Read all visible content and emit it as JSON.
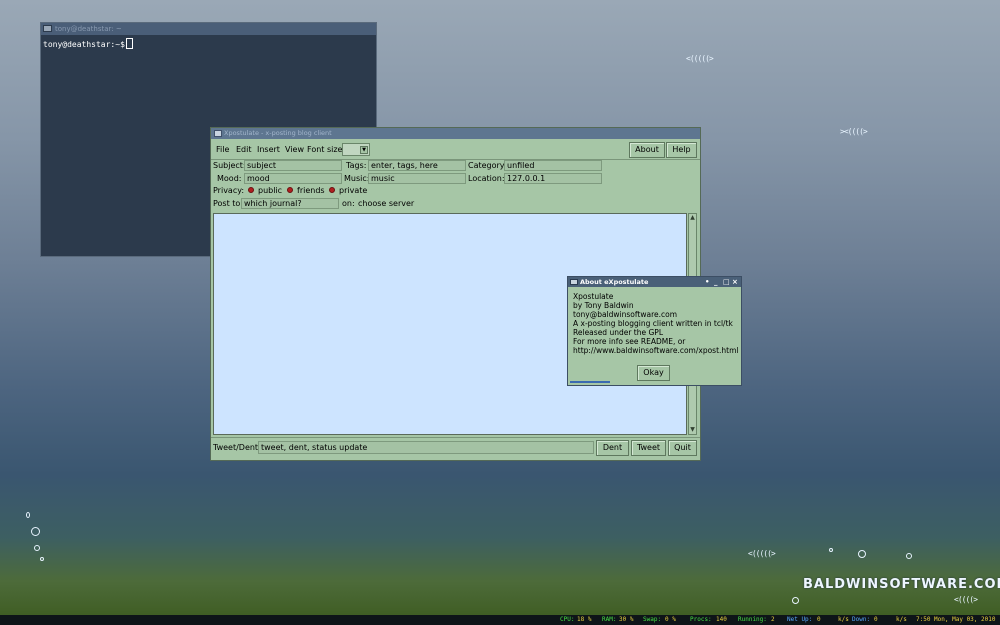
{
  "terminal": {
    "title": "tony@deathstar: ~",
    "prompt": "tony@deathstar:~$"
  },
  "xpostulate": {
    "title": "Xpostulate - x-posting blog client",
    "menu": {
      "file": "File",
      "edit": "Edit",
      "insert": "Insert",
      "view": "View",
      "font_size": "Font size:"
    },
    "buttons": {
      "about": "About",
      "help": "Help",
      "dent": "Dent",
      "tweet": "Tweet",
      "quit": "Quit"
    },
    "subject": {
      "label": "Subject:",
      "value": "subject"
    },
    "tags": {
      "label": "Tags:",
      "value": "enter, tags, here"
    },
    "category": {
      "label": "Category:",
      "value": "unfiled"
    },
    "mood": {
      "label": "Mood:",
      "value": "mood"
    },
    "music": {
      "label": "Music:",
      "value": "music"
    },
    "location": {
      "label": "Location:",
      "value": "127.0.0.1"
    },
    "privacy": {
      "label": "Privacy:",
      "public": "public",
      "friends": "friends",
      "private": "private"
    },
    "post_to": {
      "label": "Post to:",
      "value": "which journal?",
      "on_label": "on:",
      "server": "choose server"
    },
    "tweet_dent": {
      "label": "Tweet/Dent:",
      "value": "tweet, dent, status update"
    }
  },
  "about_dialog": {
    "title": "About eXpostulate",
    "lines": [
      "Xpostulate",
      " by Tony Baldwin",
      " tony@baldwinsoftware.com",
      " A x-posting blogging client written in tcl/tk",
      " Released under the GPL",
      " For more info see README, or",
      " http://www.baldwinsoftware.com/xpost.html"
    ],
    "okay_label": "Okay",
    "controls": {
      "pin": "•",
      "minimize": "_",
      "maximize": "□",
      "close": "×"
    }
  },
  "desktop": {
    "brand": "BALDWINSOFTWARE.COM"
  },
  "panel": {
    "cpu_label": "CPU:",
    "cpu_value": "18 %",
    "ram_label": "RAM:",
    "ram_value": "30 %",
    "swap_label": "Swap:",
    "swap_value": "0  %",
    "procs_label": "Procs:",
    "procs_value": "140",
    "running_label": "Running:",
    "running_value": "2",
    "net_up_label": "Net Up:",
    "net_up_value": "0",
    "net_up_unit": "k/s",
    "down_label": "Down:",
    "down_value": "0",
    "down_unit": "k/s",
    "datetime": "7:50 Mon, May 03, 2010"
  },
  "colors": {
    "window_bg": "#a6c6a6",
    "text_area": "#cde4ff",
    "panel_green": "#46e046",
    "panel_blue": "#58a8ff",
    "panel_yellow": "#e8d040"
  }
}
